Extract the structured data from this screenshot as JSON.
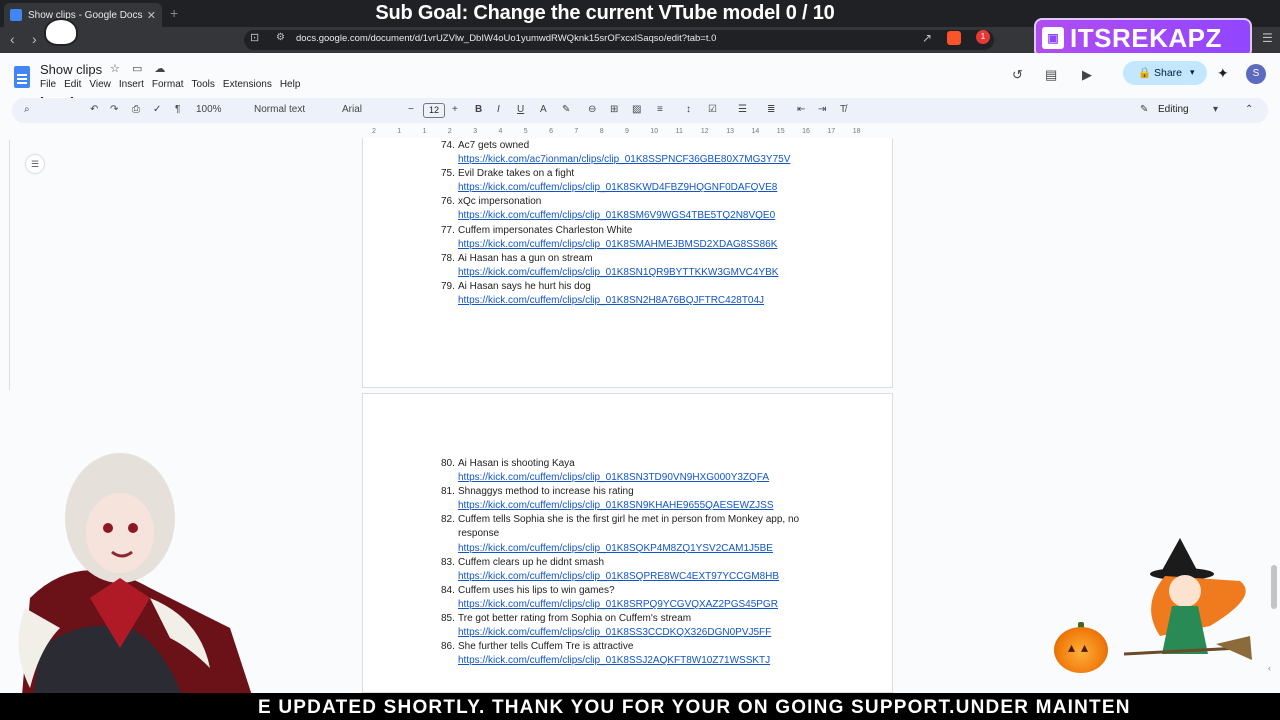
{
  "browser": {
    "tab_title": "Show clips - Google Docs",
    "url": "docs.google.com/document/d/1vrUZVlw_DbIW4oUo1yumwdRWQknk15srOFxcxlSaqso/edit?tab=t.0",
    "extension_badge": "1"
  },
  "stream": {
    "sub_goal": "Sub Goal: Change the current VTube model  0 / 10",
    "twitch_name": "ITSREKAPZ",
    "ticker": "E UPDATED SHORTLY. THANK YOU FOR YOUR ON GOING SUPPORT.UNDER MAINTEN"
  },
  "docs": {
    "title": "Show clips",
    "menu": [
      "File",
      "Edit",
      "View",
      "Insert",
      "Format",
      "Tools",
      "Extensions",
      "Help"
    ],
    "share_label": "Share",
    "avatar_letter": "S",
    "zoom": "100%",
    "style": "Normal text",
    "font": "Arial",
    "font_size": "12",
    "mode": "Editing"
  },
  "ruler": [
    "2",
    "1",
    "1",
    "2",
    "3",
    "4",
    "5",
    "6",
    "7",
    "8",
    "9",
    "10",
    "11",
    "12",
    "13",
    "14",
    "15",
    "16",
    "17",
    "18"
  ],
  "clips_page1": [
    {
      "num": "74.",
      "title": "Ac7 gets owned",
      "url": "https://kick.com/ac7ionman/clips/clip_01K8SSPNCF36GBE80X7MG3Y75V"
    },
    {
      "num": "75.",
      "title": "Evil Drake takes on a fight",
      "url": "https://kick.com/cuffem/clips/clip_01K8SKWD4FBZ9HQGNF0DAFQVE8"
    },
    {
      "num": "76.",
      "title": "xQc impersonation",
      "url": "https://kick.com/cuffem/clips/clip_01K8SM6V9WGS4TBE5TQ2N8VQE0"
    },
    {
      "num": "77.",
      "title": "Cuffem impersonates Charleston White",
      "url": "https://kick.com/cuffem/clips/clip_01K8SMAHMEJBMSD2XDAG8SS86K"
    },
    {
      "num": "78.",
      "title": "Ai Hasan has a gun on stream",
      "url": "https://kick.com/cuffem/clips/clip_01K8SN1QR9BYTTKKW3GMVC4YBK"
    },
    {
      "num": "79.",
      "title": "Ai Hasan says he hurt his dog",
      "url": "https://kick.com/cuffem/clips/clip_01K8SN2H8A76BQJFTRC428T04J"
    }
  ],
  "clips_page2": [
    {
      "num": "80.",
      "title": "Ai Hasan is shooting Kaya",
      "url": "https://kick.com/cuffem/clips/clip_01K8SN3TD90VN9HXG000Y3ZQFA"
    },
    {
      "num": "81.",
      "title": "Shnaggys method to increase his rating",
      "url": "https://kick.com/cuffem/clips/clip_01K8SN9KHAHE9655QAESEWZJSS"
    },
    {
      "num": "82.",
      "title": "Cuffem tells Sophia she is the first girl he met in person from Monkey app, no response",
      "url": "https://kick.com/cuffem/clips/clip_01K8SQKP4M8ZQ1YSV2CAM1J5BE"
    },
    {
      "num": "83.",
      "title": "Cuffem clears up he didnt smash",
      "url": "https://kick.com/cuffem/clips/clip_01K8SQPRE8WC4EXT97YCCGM8HB"
    },
    {
      "num": "84.",
      "title": "Cuffem uses his lips to win games?",
      "url": "https://kick.com/cuffem/clips/clip_01K8SRPQ9YCGVQXAZ2PGS45PGR"
    },
    {
      "num": "85.",
      "title": "Tre got better rating from Sophia on Cuffem's stream",
      "url": "https://kick.com/cuffem/clips/clip_01K8SS3CCDKQX326DGN0PVJ5FF"
    },
    {
      "num": "86.",
      "title": "She further tells Cuffem Tre is attractive",
      "url": "https://kick.com/cuffem/clips/clip_01K8SSJ2AQKFT8W10Z71WSSKTJ"
    }
  ]
}
